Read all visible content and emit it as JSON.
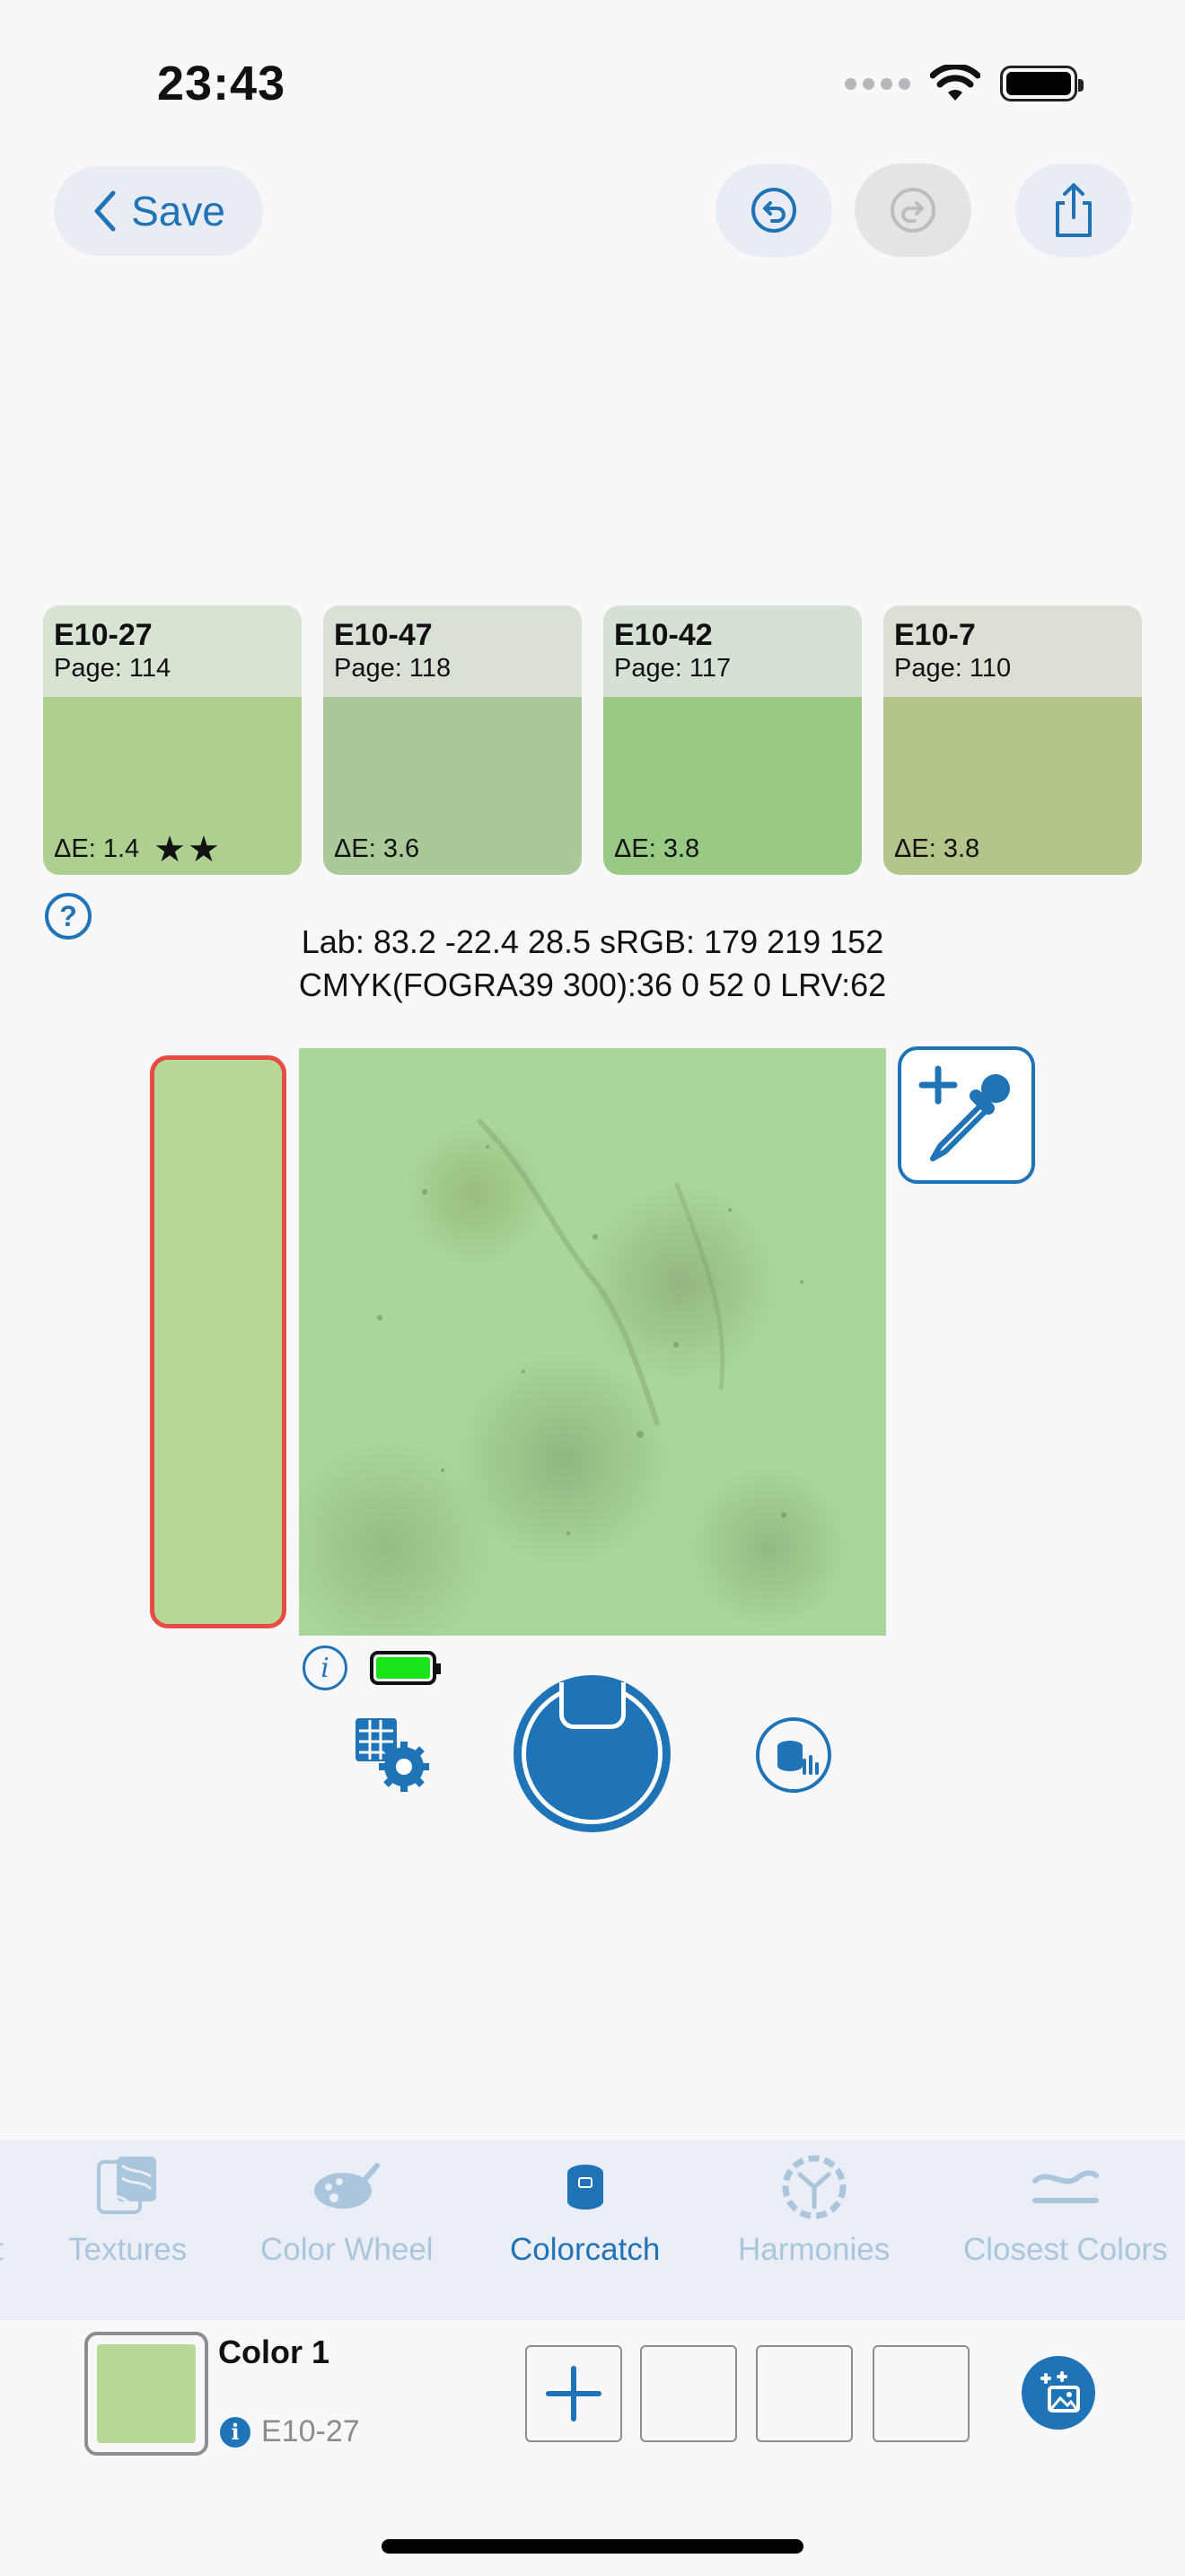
{
  "status_bar": {
    "time": "23:43"
  },
  "nav": {
    "save_label": "Save"
  },
  "swatches": [
    {
      "code": "E10-27",
      "page": "Page: 114",
      "delta": "ΔE: 1.4",
      "stars": "★★",
      "header_color": "#d7e3d3",
      "color": "#add090"
    },
    {
      "code": "E10-47",
      "page": "Page: 118",
      "delta": "ΔE: 3.6",
      "stars": "",
      "header_color": "#d9e1d7",
      "color": "#a9c999"
    },
    {
      "code": "E10-42",
      "page": "Page: 117",
      "delta": "ΔE: 3.8",
      "stars": "",
      "header_color": "#d4e1d4",
      "color": "#98ca85"
    },
    {
      "code": "E10-7",
      "page": "Page: 110",
      "delta": "ΔE: 3.8",
      "stars": "",
      "header_color": "#dcdfd3",
      "color": "#b3c58a"
    }
  ],
  "info": {
    "line1": "Lab: 83.2 -22.4 28.5 sRGB: 179 219 152",
    "line2": "CMYK(FOGRA39 300):36 0 52 0 LRV:62"
  },
  "selected_color": "#b6d995",
  "device_battery_fraction": 1.0,
  "tabs": [
    {
      "label": "t",
      "icon": "partial-tab-icon",
      "active": false
    },
    {
      "label": "Textures",
      "icon": "textures-icon",
      "active": false
    },
    {
      "label": "Color Wheel",
      "icon": "palette-icon",
      "active": false
    },
    {
      "label": "Colorcatch",
      "icon": "colorcatch-device-icon",
      "active": true
    },
    {
      "label": "Harmonies",
      "icon": "harmonies-icon",
      "active": false
    },
    {
      "label": "Closest Colors",
      "icon": "closest-colors-icon",
      "active": false
    }
  ],
  "current_color": {
    "name": "Color 1",
    "code": "E10-27"
  },
  "colors": {
    "accent": "#1f73b7",
    "inactive": "#aac6dd",
    "highlight": "#e84b44"
  }
}
